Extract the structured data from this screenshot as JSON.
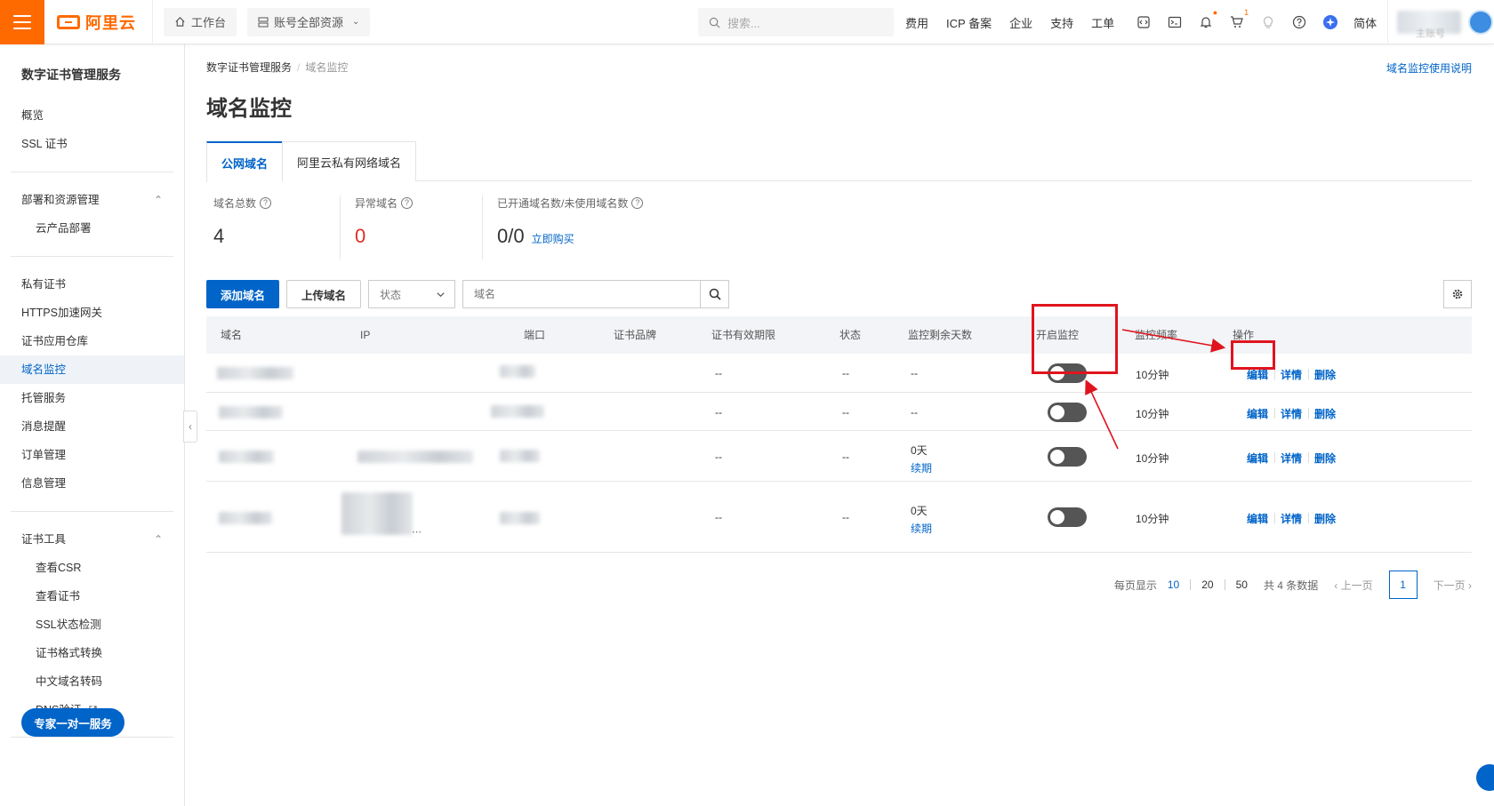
{
  "topbar": {
    "brand": "阿里云",
    "workbench": "工作台",
    "resources": "账号全部资源",
    "search_placeholder": "搜索...",
    "links": [
      "费用",
      "ICP 备案",
      "企业",
      "支持",
      "工单"
    ],
    "language": "简体",
    "cart_badge": "1",
    "sub_account": "主账号",
    "colors": {
      "brand": "#ff6a00",
      "accent": "#0064c8"
    }
  },
  "sidebar": {
    "title": "数字证书管理服务",
    "group1": [
      "概览",
      "SSL 证书"
    ],
    "group2_title": "部署和资源管理",
    "group2": [
      "云产品部署"
    ],
    "group3": [
      "私有证书",
      "HTTPS加速网关",
      "证书应用仓库",
      "域名监控",
      "托管服务",
      "消息提醒",
      "订单管理",
      "信息管理"
    ],
    "group4_title": "证书工具",
    "group4": [
      "查看CSR",
      "查看证书",
      "SSL状态检测",
      "证书格式转换",
      "中文域名转码",
      "DNS验证"
    ],
    "expert_button": "专家一对一服务"
  },
  "breadcrumb": {
    "root": "数字证书管理服务",
    "current": "域名监控"
  },
  "help_link": "域名监控使用说明",
  "page_title": "域名监控",
  "tabs": [
    "公网域名",
    "阿里云私有网络域名"
  ],
  "stats": {
    "total_label": "域名总数",
    "total_value": "4",
    "abnormal_label": "异常域名",
    "abnormal_value": "0",
    "quota_label": "已开通域名数/未使用域名数",
    "quota_value": "0/0",
    "buy_link": "立即购买"
  },
  "toolbar": {
    "add_button": "添加域名",
    "upload_button": "上传域名",
    "status_select": "状态",
    "search_placeholder": "域名"
  },
  "table": {
    "headers": [
      "域名",
      "IP",
      "端口",
      "证书品牌",
      "证书有效期限",
      "状态",
      "监控剩余天数",
      "开启监控",
      "监控频率",
      "操作"
    ],
    "rows": [
      {
        "validity": "--",
        "status": "--",
        "remaining": "--",
        "renew": "",
        "frequency": "10分钟",
        "monitor_on": false
      },
      {
        "validity": "--",
        "status": "--",
        "remaining": "--",
        "renew": "",
        "frequency": "10分钟",
        "monitor_on": false
      },
      {
        "validity": "--",
        "status": "--",
        "remaining": "0天",
        "renew": "续期",
        "frequency": "10分钟",
        "monitor_on": false
      },
      {
        "validity": "--",
        "status": "--",
        "remaining": "0天",
        "renew": "续期",
        "frequency": "10分钟",
        "monitor_on": false
      }
    ],
    "actions": {
      "edit": "编辑",
      "detail": "详情",
      "delete": "删除"
    }
  },
  "pagination": {
    "per_page_label": "每页显示",
    "sizes": [
      "10",
      "20",
      "50"
    ],
    "total": "共 4 条数据",
    "prev": "上一页",
    "next": "下一页",
    "current": "1"
  },
  "annotation_color": "#e0141e"
}
